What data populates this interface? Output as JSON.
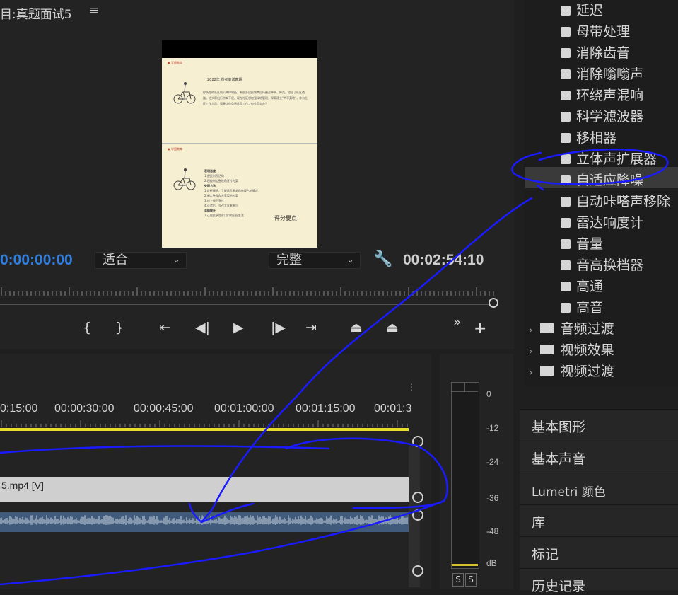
{
  "monitor": {
    "title": "目:真题面试5",
    "menu_icon": "hamburger-icon",
    "timecode_current": "0:00:00:00",
    "fit_select": "适合",
    "quality_select": "完整",
    "timecode_total": "00:02:54:10",
    "preview": {
      "header_a": "▣ 学图教育",
      "header_b": "▣ 学图教育",
      "doc_title": "2022年 省考面试真题",
      "doc_para": "你所在的社区的公共绿地处，有很多居民将其自行圈占种草、种菜，侵占了社区道路。给大家出行带来不便。现在社区想加强绿地管理，探索建立“共享菜地”，作为社区工作人员，如果让你负责此项工作，你会怎么办？",
      "doc_list": [
        "表明态度",
        "1.便民利民活动",
        "2.积极制定整改和宣传方案",
        "处理方法",
        "1.进行调研，了解居民需求和违规占地情况",
        "2.制定整改和共享菜地方案",
        "3.线上线下宣传",
        "4.试验后，号召大家来参与",
        "总结提升",
        "1.让居民享受家门口的田园生活"
      ],
      "score_label": "评分要点"
    }
  },
  "timeline": {
    "labels": [
      "0:15:00",
      "00:00:30:00",
      "00:00:45:00",
      "00:01:00:00",
      "00:01:15:00",
      "00:01:3"
    ],
    "video_clip": "5.mp4 [V]"
  },
  "meter": {
    "db_labels": [
      "0",
      "-12",
      "-24",
      "-36",
      "-48",
      "dB"
    ],
    "solo_left": "S",
    "solo_right": "S"
  },
  "effects": {
    "items": [
      "延迟",
      "母带处理",
      "消除齿音",
      "消除嗡嗡声",
      "环绕声混响",
      "科学滤波器",
      "移相器",
      "立体声扩展器",
      "自适应降噪",
      "自动咔嗒声移除",
      "雷达响度计",
      "音量",
      "音高换档器",
      "高通",
      "高音"
    ],
    "selected": "自适应降噪",
    "folders": [
      "音频过渡",
      "视频效果",
      "视频过渡"
    ]
  },
  "panels": [
    "基本图形",
    "基本声音",
    "Lumetri 颜色",
    "库",
    "标记",
    "历史记录"
  ],
  "annotation_color": "#1a1aff"
}
